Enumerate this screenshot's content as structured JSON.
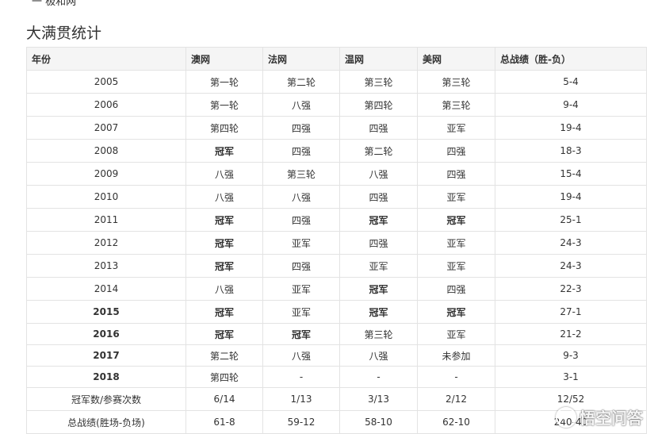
{
  "top_fragment": "一 极和网",
  "section_title": "大满贯统计",
  "table": {
    "headers": [
      "年份",
      "澳网",
      "法网",
      "温网",
      "美网",
      "总战绩（胜-负）"
    ],
    "rows": [
      {
        "year": "2005",
        "ao": "第一轮",
        "fo": "第二轮",
        "wb": "第三轮",
        "uso": "第三轮",
        "record": "5-4"
      },
      {
        "year": "2006",
        "ao": "第一轮",
        "fo": "八强",
        "wb": "第四轮",
        "uso": "第三轮",
        "record": "9-4"
      },
      {
        "year": "2007",
        "ao": "第四轮",
        "fo": "四强",
        "wb": "四强",
        "uso": "亚军",
        "record": "19-4"
      },
      {
        "year": "2008",
        "ao": "冠军",
        "fo": "四强",
        "wb": "第二轮",
        "uso": "四强",
        "record": "18-3"
      },
      {
        "year": "2009",
        "ao": "八强",
        "fo": "第三轮",
        "wb": "八强",
        "uso": "四强",
        "record": "15-4"
      },
      {
        "year": "2010",
        "ao": "八强",
        "fo": "八强",
        "wb": "四强",
        "uso": "亚军",
        "record": "19-4"
      },
      {
        "year": "2011",
        "ao": "冠军",
        "fo": "四强",
        "wb": "冠军",
        "uso": "冠军",
        "record": "25-1"
      },
      {
        "year": "2012",
        "ao": "冠军",
        "fo": "亚军",
        "wb": "四强",
        "uso": "亚军",
        "record": "24-3"
      },
      {
        "year": "2013",
        "ao": "冠军",
        "fo": "四强",
        "wb": "亚军",
        "uso": "亚军",
        "record": "24-3"
      },
      {
        "year": "2014",
        "ao": "八强",
        "fo": "亚军",
        "wb": "冠军",
        "uso": "四强",
        "record": "22-3"
      },
      {
        "year": "2015",
        "ao": "冠军",
        "fo": "亚军",
        "wb": "冠军",
        "uso": "冠军",
        "record": "27-1"
      },
      {
        "year": "2016",
        "ao": "冠军",
        "fo": "冠军",
        "wb": "第三轮",
        "uso": "亚军",
        "record": "21-2"
      },
      {
        "year": "2017",
        "ao": "第二轮",
        "fo": "八强",
        "wb": "八强",
        "uso": "未参加",
        "record": "9-3"
      },
      {
        "year": "2018",
        "ao": "第四轮",
        "fo": "-",
        "wb": "-",
        "uso": "-",
        "record": "3-1"
      }
    ],
    "summary_rows": [
      {
        "label": "冠军数/参赛次数",
        "ao": "6/14",
        "fo": "1/13",
        "wb": "3/13",
        "uso": "2/12",
        "record": "12/52"
      },
      {
        "label": "总战绩(胜场-负场)",
        "ao": "61-8",
        "fo": "59-12",
        "wb": "58-10",
        "uso": "62-10",
        "record": "240-40"
      }
    ],
    "bold_value": "冠军"
  },
  "watermark": {
    "text": "悟空问答",
    "icon": "wukong-logo-icon"
  }
}
